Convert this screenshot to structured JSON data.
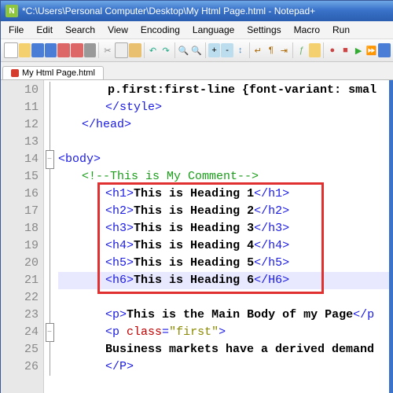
{
  "title": "*C:\\Users\\Personal Computer\\Desktop\\My Html Page.html - Notepad+",
  "menu": [
    "File",
    "Edit",
    "Search",
    "View",
    "Encoding",
    "Language",
    "Settings",
    "Macro",
    "Run"
  ],
  "tab": {
    "label": "My Html Page.html"
  },
  "gutter": [
    "10",
    "11",
    "12",
    "13",
    "14",
    "15",
    "16",
    "17",
    "18",
    "19",
    "20",
    "21",
    "22",
    "23",
    "24",
    "25",
    "26"
  ],
  "lines": {
    "l10": {
      "pre": "       ",
      "style": "p.first:first-line {font-variant: smal"
    },
    "l11": {
      "open": "</",
      "tag": "style",
      "close": ">"
    },
    "l12": {
      "open": "</",
      "tag": "head",
      "close": ">"
    },
    "l14": {
      "open": "<",
      "tag": "body",
      "close": ">"
    },
    "l15": {
      "open": "<!--",
      "text": "This is My Comment",
      "close": "-->"
    },
    "l16": {
      "o": "<",
      "t": "h1",
      "c": ">",
      "txt": "This is Heading 1",
      "o2": "</",
      "t2": "h1",
      "c2": ">"
    },
    "l17": {
      "o": "<",
      "t": "h2",
      "c": ">",
      "txt": "This is Heading 2",
      "o2": "</",
      "t2": "h2",
      "c2": ">"
    },
    "l18": {
      "o": "<",
      "t": "h3",
      "c": ">",
      "txt": "This is Heading 3",
      "o2": "</",
      "t2": "h3",
      "c2": ">"
    },
    "l19": {
      "o": "<",
      "t": "h4",
      "c": ">",
      "txt": "This is Heading 4",
      "o2": "</",
      "t2": "h4",
      "c2": ">"
    },
    "l20": {
      "o": "<",
      "t": "h5",
      "c": ">",
      "txt": "This is Heading 5",
      "o2": "</",
      "t2": "h5",
      "c2": ">"
    },
    "l21": {
      "o": "<",
      "t": "h6",
      "c": ">",
      "txt": "This is Heading 6",
      "o2": "</",
      "t2": "H6",
      "c2": ">"
    },
    "l23": {
      "o": "<",
      "t": "p",
      "c": ">",
      "txt": "This is the Main Body of my Page",
      "o2": "</",
      "t2": "p"
    },
    "l24": {
      "o": "<",
      "t": "p ",
      "attr": "class",
      "eq": "=",
      "val": "\"first\"",
      "c": ">"
    },
    "l25": {
      "txt": "Business markets have a derived demand"
    },
    "l26": {
      "o": "</",
      "t": "P",
      "c": ">"
    }
  }
}
